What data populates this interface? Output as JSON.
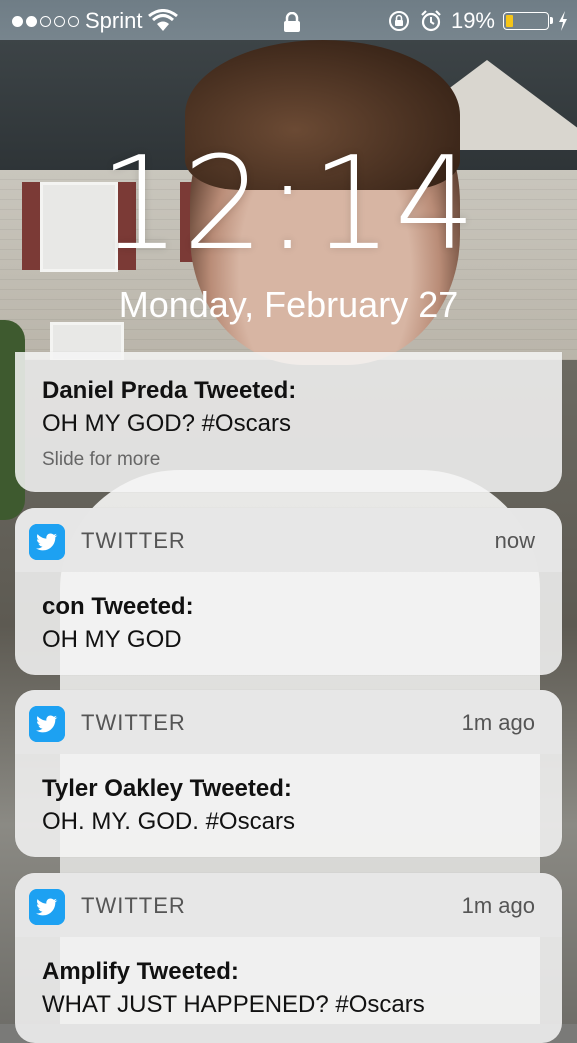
{
  "status_bar": {
    "carrier": "Sprint",
    "signal_bars": 2,
    "signal_total": 5,
    "battery_percent": "19%",
    "battery_level": 0.19,
    "battery_color": "#f5c518"
  },
  "lock_screen": {
    "time": "12:14",
    "date": "Monday, February 27"
  },
  "notifications": [
    {
      "title": "Daniel Preda Tweeted:",
      "message": "OH MY GOD? #Oscars",
      "hint": "Slide for more"
    },
    {
      "app": "TWITTER",
      "time": "now",
      "title": "con Tweeted:",
      "message": "OH MY GOD",
      "icon": "twitter-bird-icon"
    },
    {
      "app": "TWITTER",
      "time": "1m ago",
      "title": "Tyler Oakley Tweeted:",
      "message": "OH. MY. GOD. #Oscars",
      "icon": "twitter-bird-icon"
    },
    {
      "app": "TWITTER",
      "time": "1m ago",
      "title": "Amplify Tweeted:",
      "message": "WHAT JUST HAPPENED? #Oscars",
      "icon": "twitter-bird-icon"
    }
  ],
  "colors": {
    "twitter_blue": "#1da1f2"
  }
}
